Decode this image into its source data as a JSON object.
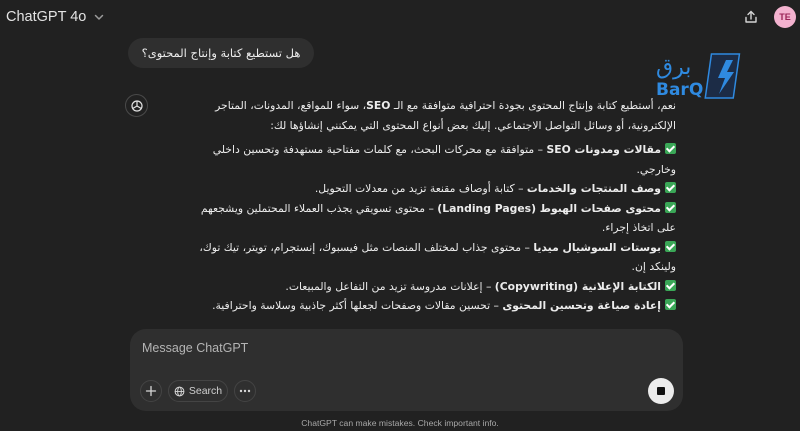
{
  "header": {
    "model_title": "ChatGPT 4o",
    "avatar_initials": "TE"
  },
  "chat": {
    "user_message": "هل تستطيع كتابة وإنتاج المحتوى؟",
    "assistant": {
      "intro_part1": "نعم، أستطيع كتابة وإنتاج المحتوى بجودة احترافية متوافقة مع الـ ",
      "intro_bold": "SEO",
      "intro_part2": "، سواء للمواقع، المدونات، المتاجر الإلكترونية، أو وسائل التواصل الاجتماعي. إليك بعض أنواع المحتوى التي يمكنني إنشاؤها لك:",
      "items": [
        {
          "title": "مقالات ومدونات SEO",
          "desc": " – متوافقة مع محركات البحث، مع كلمات مفتاحية مستهدفة وتحسين داخلي وخارجي."
        },
        {
          "title": "وصف المنتجات والخدمات",
          "desc": " – كتابة أوصاف مقنعة تزيد من معدلات التحويل."
        },
        {
          "title": "محتوى صفحات الهبوط (Landing Pages)",
          "desc": " – محتوى تسويقي يجذب العملاء المحتملين ويشجعهم على اتخاذ إجراء."
        },
        {
          "title": "بوستات السوشيال ميديا",
          "desc": " – محتوى جذاب لمختلف المنصات مثل فيسبوك، إنستجرام، تويتر، تيك توك، ولينكد إن."
        },
        {
          "title": "الكتابة الإعلانية (Copywriting)",
          "desc": " – إعلانات مدروسة تزيد من التفاعل والمبيعات."
        },
        {
          "title": "إعادة صياغة وتحسين المحتوى",
          "desc": " – تحسين مقالات وصفحات لجعلها أكثر جاذبية وسلاسة واحترافية."
        }
      ]
    }
  },
  "logo": {
    "text_ar": "برق",
    "text_en": "BarQ"
  },
  "composer": {
    "placeholder": "Message ChatGPT",
    "search_label": "Search"
  },
  "footer": {
    "disclaimer": "ChatGPT can make mistakes. Check important info."
  },
  "colors": {
    "background": "#212121",
    "surface": "#2f2f2f",
    "check_green": "#3aa757",
    "logo_blue": "#1f78c8",
    "avatar_pink": "#f3b2cf"
  }
}
